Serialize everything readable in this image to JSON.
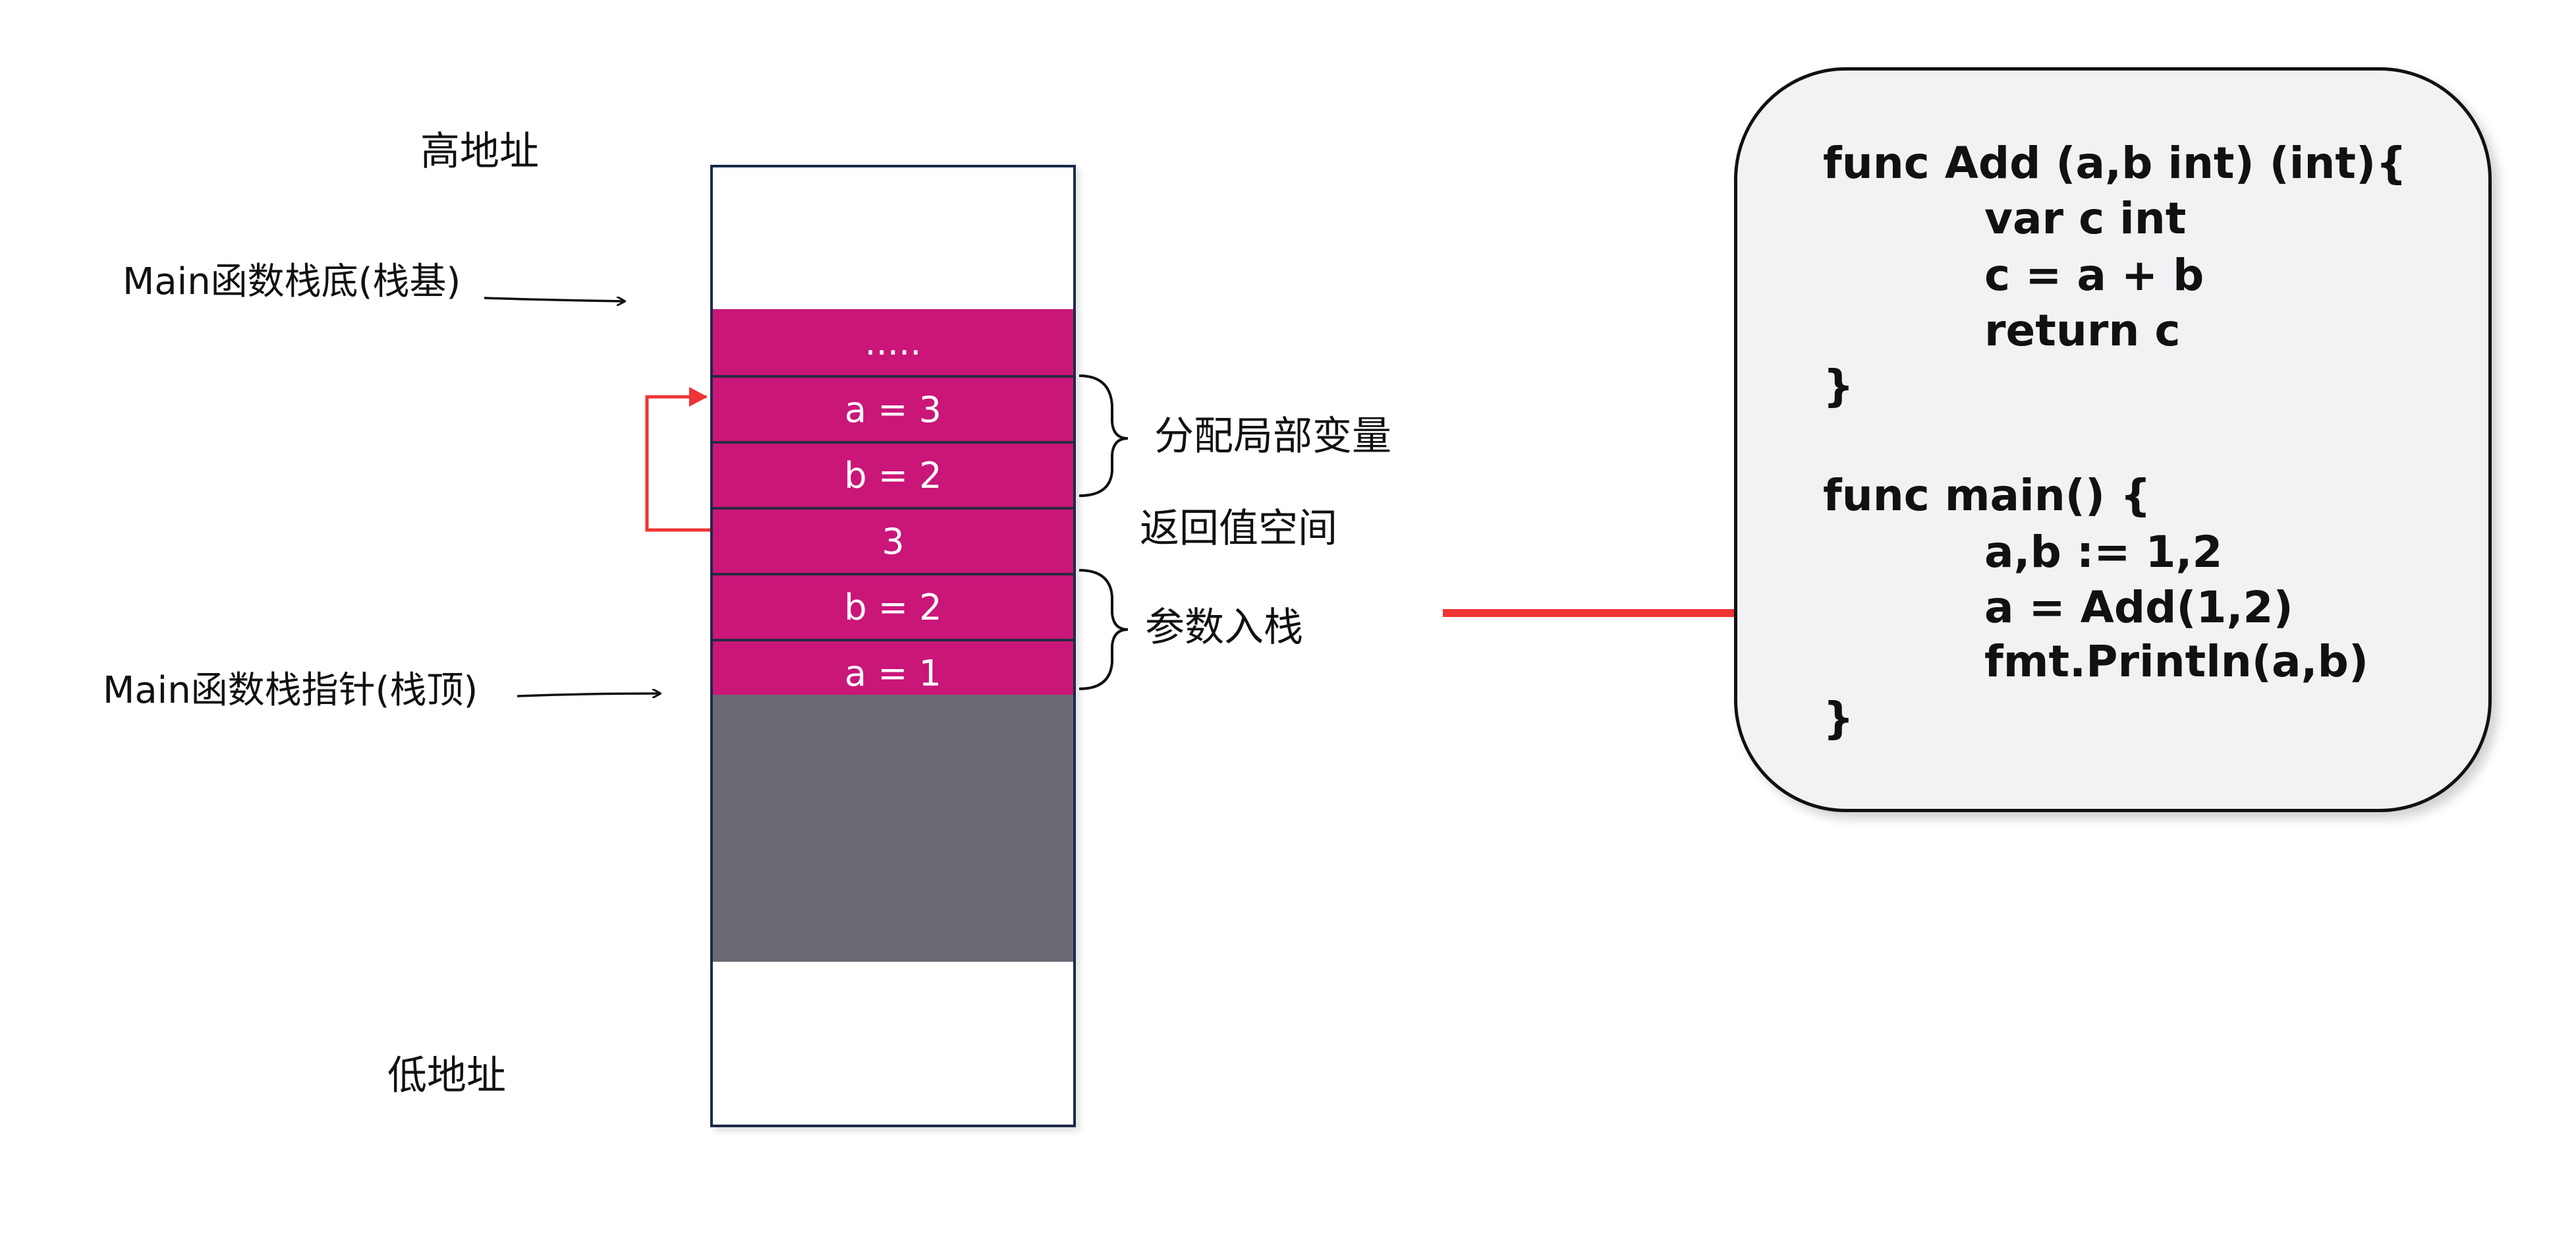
{
  "labels": {
    "high_address": "高地址",
    "low_address": "低地址",
    "main_stack_base": "Main函数栈底(栈基)",
    "main_stack_pointer": "Main函数栈指针(栈顶)",
    "alloc_locals": "分配局部变量",
    "return_space": "返回值空间",
    "params_push": "参数入栈"
  },
  "stack_cells": [
    {
      "text": "....."
    },
    {
      "text": "a = 3"
    },
    {
      "text": "b = 2"
    },
    {
      "text": "3"
    },
    {
      "text": "b = 2"
    },
    {
      "text": "a = 1"
    }
  ],
  "code": {
    "lines": [
      "func Add (a,b int) (int){",
      "var c int",
      "c = a + b",
      "return c",
      "}",
      "func main() {",
      "a,b := 1,2",
      "a = Add(1,2)",
      "fmt.Println(a,b)",
      "}"
    ]
  },
  "colors": {
    "stack_cell": "#c91678",
    "stack_free": "#6b6a73",
    "arrow_red": "#ef3434",
    "outline": "#1a2a4a",
    "code_bg": "#f1f2f4"
  }
}
